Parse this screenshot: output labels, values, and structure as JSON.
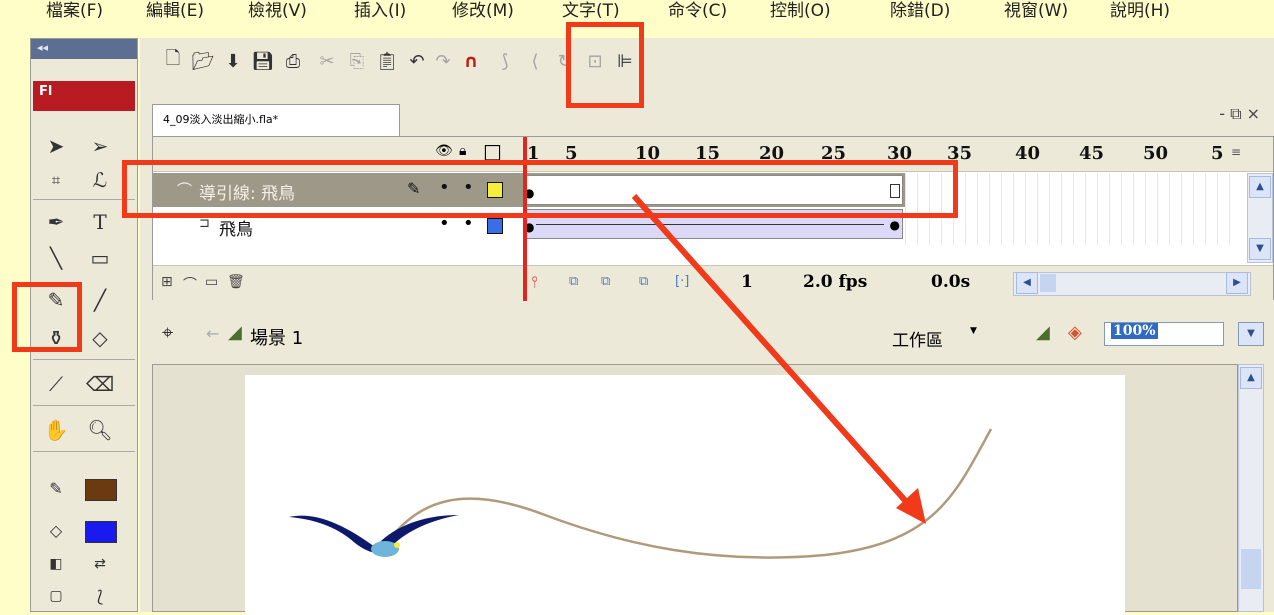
{
  "menu": {
    "items": [
      "檔案(F)",
      "編輯(E)",
      "檢視(V)",
      "插入(I)",
      "修改(M)",
      "文字(T)",
      "命令(C)",
      "控制(O)",
      "除錯(D)",
      "視窗(W)",
      "說明(H)"
    ]
  },
  "toolbox": {
    "collapse": "◂◂",
    "logo": "Fl",
    "tools": [
      "selection-icon",
      "subselection-icon",
      "free-transform-icon",
      "lasso-icon",
      "pen-icon",
      "text-icon",
      "line-icon",
      "rectangle-icon",
      "pencil-icon",
      "brush-icon",
      "ink-bottle-icon",
      "paint-bucket-icon",
      "eyedropper-icon",
      "eraser-icon",
      "hand-icon",
      "zoom-icon"
    ]
  },
  "document": {
    "tab_title": "4_09淡入淡出縮小.fla*",
    "window_controls": "- ⧉ ×"
  },
  "timeline": {
    "frame_labels": [
      "1",
      "5",
      "10",
      "15",
      "20",
      "25",
      "30",
      "35",
      "40",
      "45",
      "50",
      "5"
    ],
    "layers": [
      {
        "name": "導引線: 飛鳥",
        "color": "#f5ee3a"
      },
      {
        "name": "飛鳥",
        "color": "#3a6ee8"
      }
    ],
    "current_frame": "1",
    "fps": "2.0 fps",
    "elapsed": "0.0s"
  },
  "scene": {
    "label": "場景 1",
    "workspace": "工作區",
    "zoom": "100%"
  },
  "colors": {
    "highlight": "#f03a1a",
    "arrow": "#f03a1a",
    "stroke_swatch": "#6b3a10",
    "fill_swatch": "#1a1aee"
  }
}
